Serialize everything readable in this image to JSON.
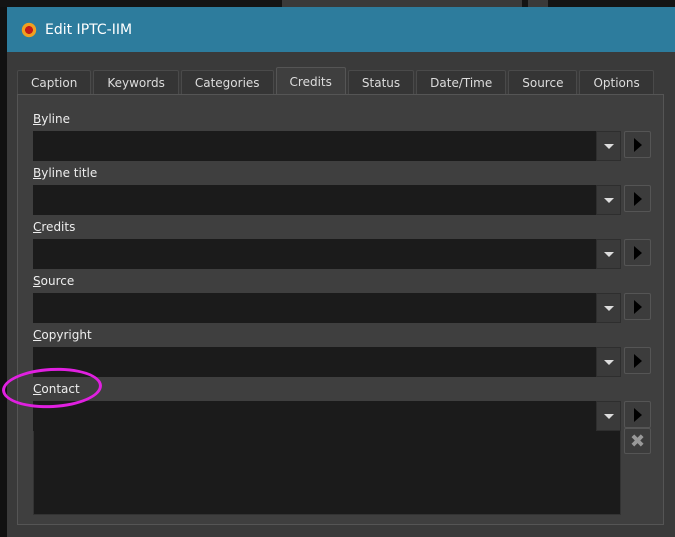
{
  "window": {
    "title": "Edit IPTC-IIM"
  },
  "tabs": [
    {
      "label": "Caption"
    },
    {
      "label": "Keywords"
    },
    {
      "label": "Categories"
    },
    {
      "label": "Credits"
    },
    {
      "label": "Status"
    },
    {
      "label": "Date/Time"
    },
    {
      "label": "Source"
    },
    {
      "label": "Options"
    }
  ],
  "active_tab": "Credits",
  "fields": [
    {
      "label": "Byline",
      "accel": "B",
      "rest": "yline",
      "value": ""
    },
    {
      "label": "Byline title",
      "accel": "B",
      "rest": "yline title",
      "value": ""
    },
    {
      "label": "Credits",
      "accel": "C",
      "rest": "redits",
      "value": ""
    },
    {
      "label": "Source",
      "accel": "S",
      "rest": "ource",
      "value": ""
    },
    {
      "label": "Copyright",
      "accel": "C",
      "rest": "opyright",
      "value": ""
    },
    {
      "label": "Contact",
      "accel": "C",
      "rest": "ontact",
      "value": ""
    }
  ],
  "annotation_color": "#e020e0"
}
